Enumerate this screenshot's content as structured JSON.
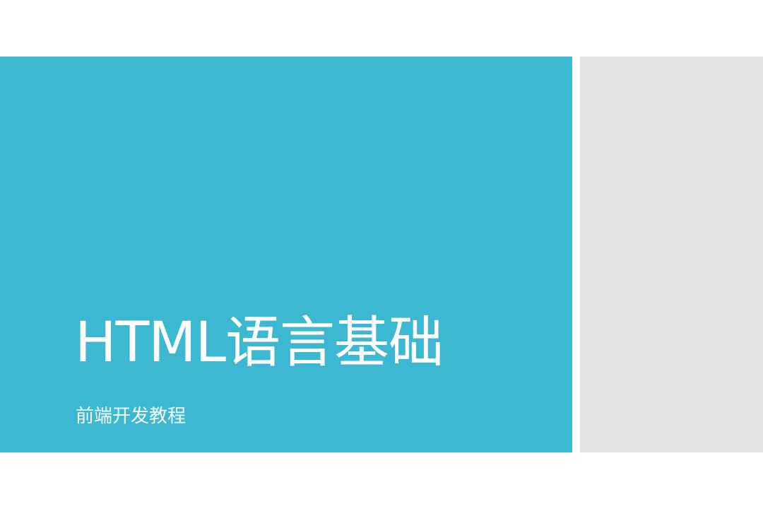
{
  "slide": {
    "title": "HTML语言基础",
    "subtitle": "前端开发教程",
    "colors": {
      "accent": "#3DB8D3",
      "side_panel": "#E3E3E3",
      "text": "#FFFFFF"
    }
  }
}
